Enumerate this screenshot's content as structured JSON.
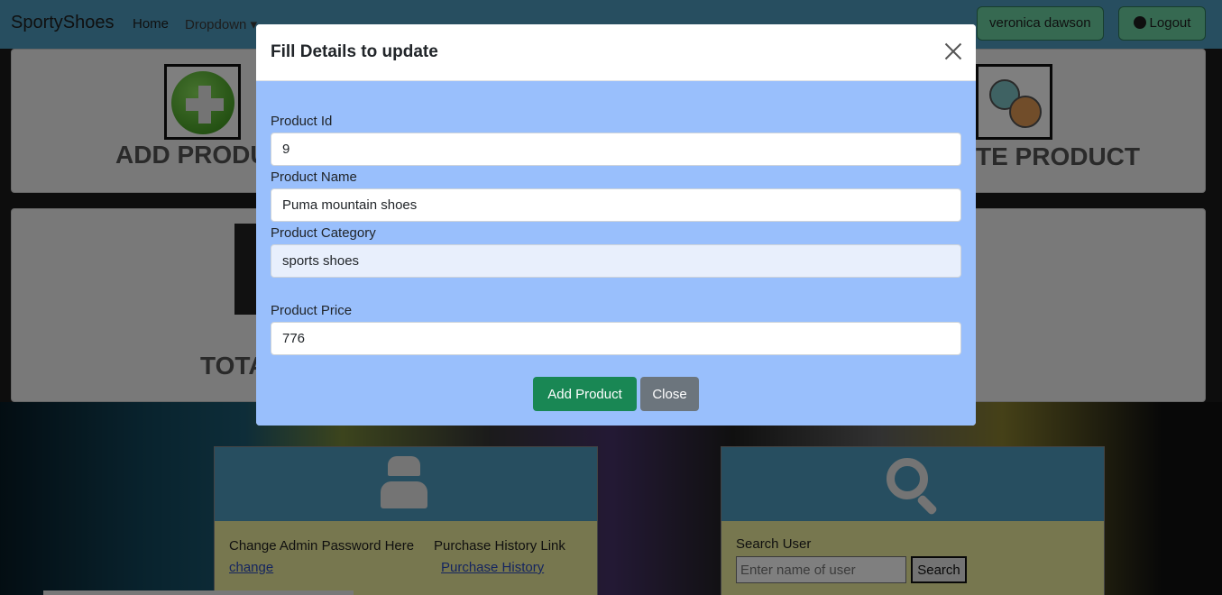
{
  "navbar": {
    "brand": "SportyShoes",
    "home": "Home",
    "dropdown": "Dropdown",
    "user": "veronica dawson",
    "logout": "Logout"
  },
  "cards": {
    "add_title": "ADD PRODU",
    "update_title": "TE PRODUCT",
    "total_title": "TOTA"
  },
  "panels": {
    "admin": {
      "change_password_text": "Change Admin Password Here",
      "change_link": "change",
      "purchase_history_text": "Purchase History Link",
      "purchase_history_link": "Purchase History"
    },
    "search": {
      "label": "Search User",
      "placeholder": "Enter name of user",
      "button": "Search"
    }
  },
  "modal": {
    "title": "Fill Details to update",
    "fields": {
      "product_id_label": "Product Id",
      "product_id_value": "9",
      "product_name_label": "Product Name",
      "product_name_value": "Puma mountain shoes",
      "product_category_label": "Product Category",
      "product_category_value": "sports shoes",
      "product_price_label": "Product Price",
      "product_price_value": "776"
    },
    "add_button": "Add Product",
    "close_button": "Close"
  },
  "colors": {
    "navbar": "#4f9dc0",
    "modal_body": "#99bffc",
    "add_button": "#198754",
    "close_button": "#6c757d",
    "panel_body": "#efee9e"
  }
}
